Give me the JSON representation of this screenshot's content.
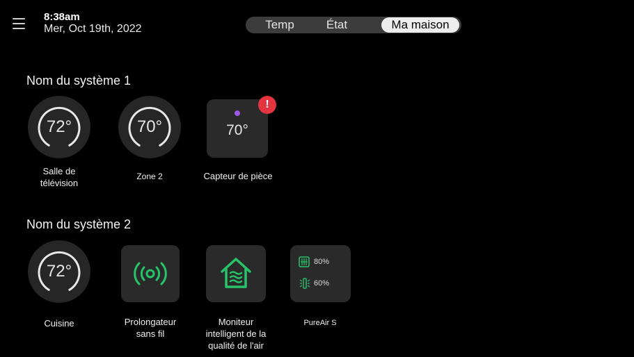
{
  "header": {
    "time": "8:38am",
    "date": "Mer, Oct 19th, 2022"
  },
  "tabs": [
    {
      "label": "Temp"
    },
    {
      "label": "État"
    },
    {
      "label": "Ma maison",
      "active": true
    }
  ],
  "system1": {
    "title": "Nom du système 1",
    "devices": [
      {
        "value": "72°",
        "label_line1": "Salle de",
        "label_line2": "télévision"
      },
      {
        "value": "70°",
        "label": "Zone 2"
      },
      {
        "value": "70°",
        "label": "Capteur de pièce",
        "alert": "!"
      }
    ]
  },
  "system2": {
    "title": "Nom du système 2",
    "devices": [
      {
        "value": "72°",
        "label": "Cuisine"
      },
      {
        "label_line1": "Prolongateur",
        "label_line2": "sans fil"
      },
      {
        "label_line1": "Moniteur",
        "label_line2": "intelligent de la",
        "label_line3": "qualité de l'air"
      },
      {
        "filter_pct": "80%",
        "humidity_pct": "60%",
        "label": "PureAir S"
      }
    ]
  },
  "colors": {
    "accent_green": "#27c46a",
    "alert_red": "#e3343f",
    "sensor_dot": "#9b59e6"
  }
}
